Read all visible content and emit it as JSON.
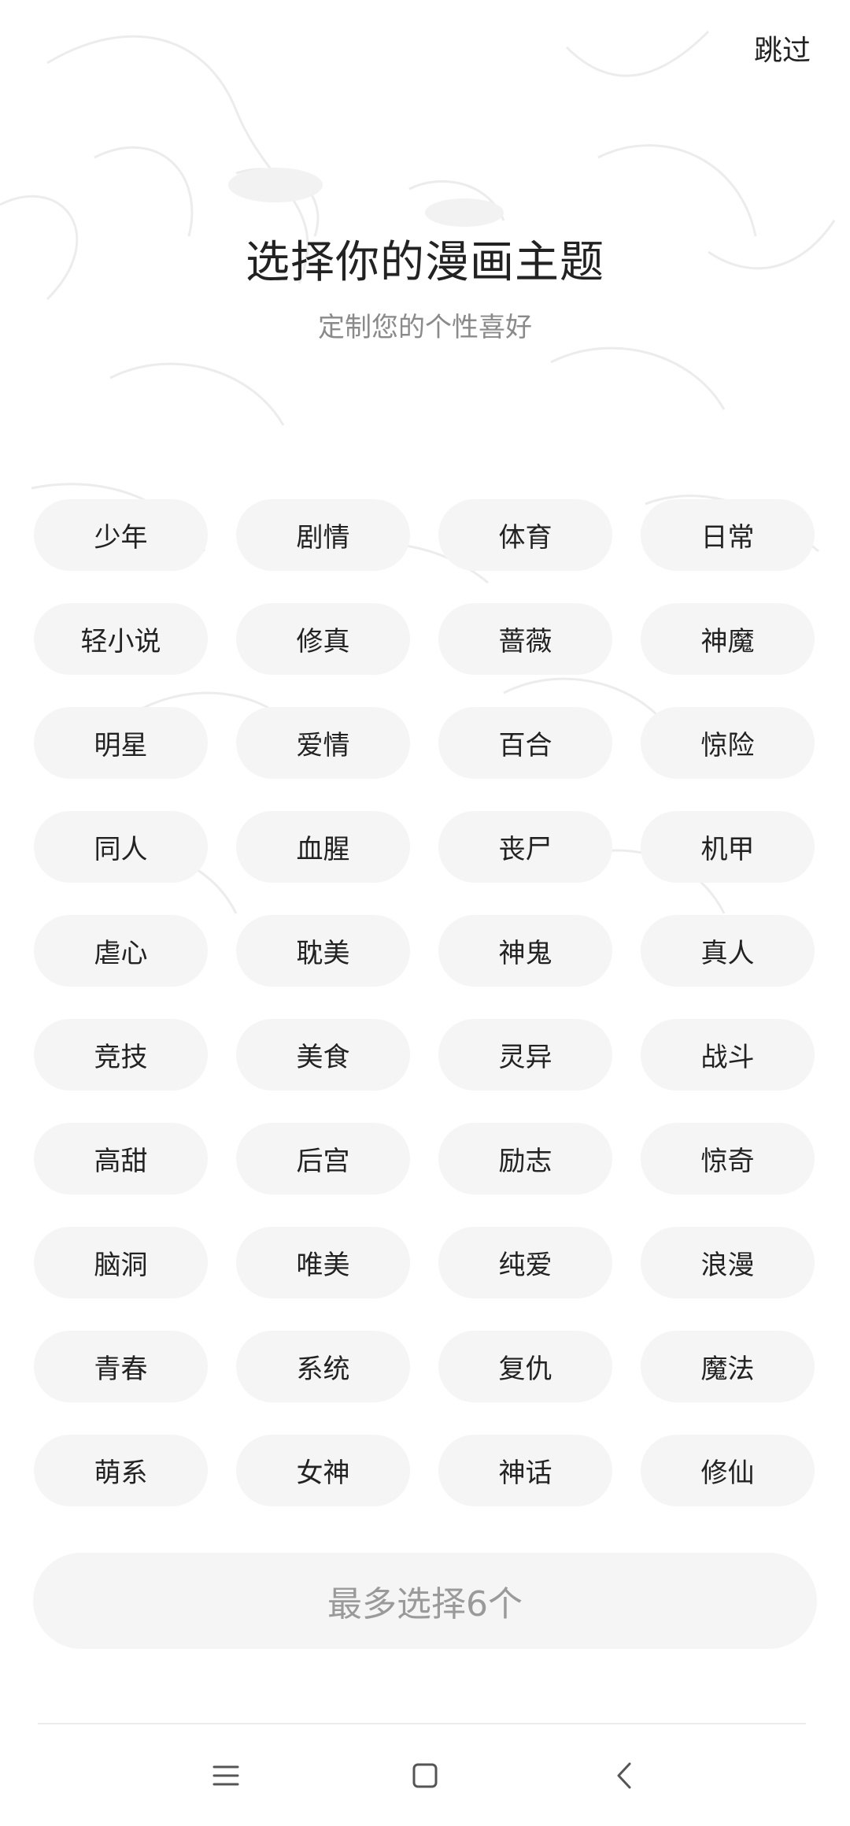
{
  "header": {
    "skip_label": "跳过"
  },
  "main": {
    "title": "选择你的漫画主题",
    "subtitle": "定制您的个性喜好",
    "tags": [
      "少年",
      "剧情",
      "体育",
      "日常",
      "轻小说",
      "修真",
      "蔷薇",
      "神魔",
      "明星",
      "爱情",
      "百合",
      "惊险",
      "同人",
      "血腥",
      "丧尸",
      "机甲",
      "虐心",
      "耽美",
      "神鬼",
      "真人",
      "竞技",
      "美食",
      "灵异",
      "战斗",
      "高甜",
      "后宫",
      "励志",
      "惊奇",
      "脑洞",
      "唯美",
      "纯爱",
      "浪漫",
      "青春",
      "系统",
      "复仇",
      "魔法",
      "萌系",
      "女神",
      "神话",
      "修仙"
    ],
    "confirm_label": "最多选择6个"
  },
  "navbar": {
    "icons": [
      "menu-icon",
      "home-icon",
      "back-icon"
    ]
  },
  "colors": {
    "tag_bg": "#f5f5f5",
    "text_primary": "#222222",
    "text_secondary": "#8a8a8a",
    "button_text_disabled": "#9a9a9a"
  }
}
